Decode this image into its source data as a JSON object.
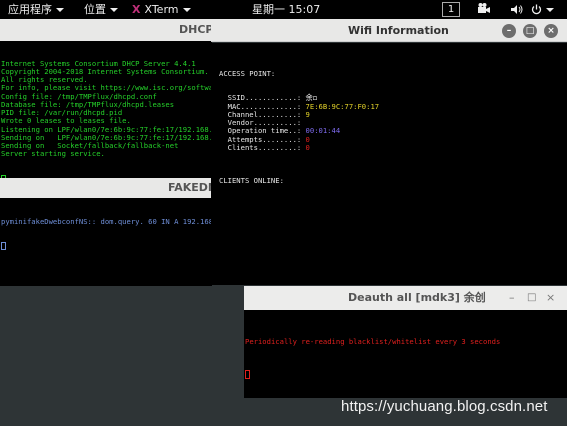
{
  "topbar": {
    "apps_label": "应用程序",
    "places_label": "位置",
    "xterm_label": "XTerm",
    "clock": "星期一 15:07",
    "workspace": "1"
  },
  "dhcp": {
    "title": "DHCP",
    "lines": [
      "Internet Systems Consortium DHCP Server 4.4.1",
      "Copyright 2004-2018 Internet Systems Consortium.",
      "All rights reserved.",
      "For info, please visit https://www.isc.org/softwa",
      "Config file: /tmp/TMPflux/dhcpd.conf",
      "Database file: /tmp/TMPflux/dhcpd.leases",
      "PID file: /var/run/dhcpd.pid",
      "Wrote 0 leases to leases file.",
      "Listening on LPF/wlan0/7e:6b:9c:77:fe:17/192.168.",
      "Sending on   LPF/wlan0/7e:6b:9c:77:fe:17/192.168.",
      "Sending on   Socket/fallback/fallback-net",
      "Server starting service."
    ]
  },
  "fakedns": {
    "title": "FAKEDN",
    "line": "pyminifakeDwebconfNS:: dom.query. 60 IN A 192.168"
  },
  "wifi": {
    "title": "Wifi Information",
    "access_point_label": "ACCESS POINT:",
    "fields": [
      {
        "label": "  SSID............:",
        "value": " 余◻",
        "color": "#ffffff"
      },
      {
        "label": "  MAC.............:",
        "value": " 7E:6B:9C:77:F0:17",
        "color": "#e6d52a"
      },
      {
        "label": "  Channel.........:",
        "value": " 9",
        "color": "#e6d52a"
      },
      {
        "label": "  Vendor..........:",
        "value": "",
        "color": "#ffffff"
      },
      {
        "label": "  Operation time..:",
        "value": " 00:01:44",
        "color": "#7f6cf0"
      },
      {
        "label": "  Attempts........:",
        "value": " 0",
        "color": "#e0201e"
      },
      {
        "label": "  Clients.........:",
        "value": " 0",
        "color": "#e0201e"
      }
    ],
    "clients_label": "CLIENTS ONLINE:"
  },
  "deauth": {
    "title": "Deauth all [mdk3]  余创",
    "line": "Periodically re-reading blacklist/whitelist every 3 seconds"
  },
  "watermark": "https://yuchuang.blog.csdn.net"
}
